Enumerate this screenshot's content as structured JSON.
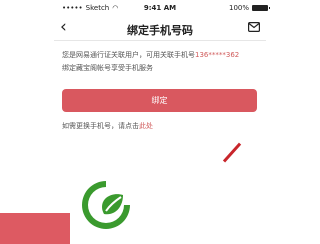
{
  "status_bar": {
    "carrier": "Sketch",
    "time": "9:41 AM",
    "battery_percent": "100%"
  },
  "nav": {
    "title": "绑定手机号码",
    "back_icon": "chevron-left-icon",
    "mail_icon": "envelope-icon"
  },
  "info": {
    "line1_prefix": "您是网易通行证关联用户，可用关联手机号",
    "phone_masked": "136*****362",
    "line2": "绑定藏宝阁帐号享受手机服务"
  },
  "bind_button": {
    "label": "绑定"
  },
  "change_tip": {
    "text": "如需更换手机号，请点击",
    "link": "此处"
  },
  "colors": {
    "accent": "#d9585f",
    "link": "#d05a5a",
    "logo_green": "#3a9a2e"
  }
}
